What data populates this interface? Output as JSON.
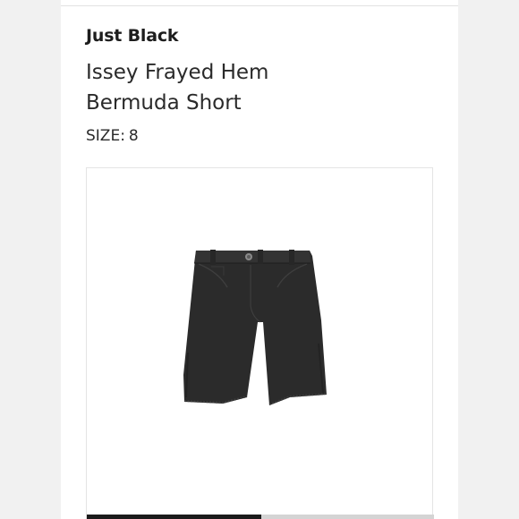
{
  "product": {
    "brand": "Just Black",
    "title": "Issey Frayed Hem Bermuda Short",
    "size_label": "SIZE:",
    "size_value": "8",
    "image_icon": "denim-shorts-photo"
  },
  "gallery": {
    "selected_index": 0,
    "image_count": 2
  },
  "colors": {
    "background": "#f1f1f1",
    "card": "#ffffff",
    "text": "#2a2a2a",
    "garment": "#2b2b2b"
  }
}
